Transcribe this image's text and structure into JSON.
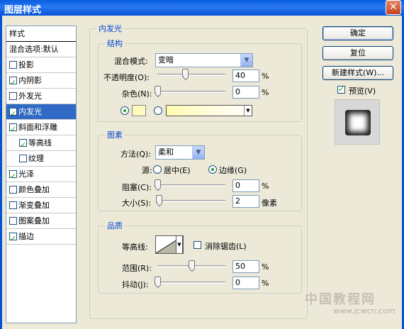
{
  "window": {
    "title": "图层样式"
  },
  "sidebar": {
    "header": "样式",
    "items": [
      {
        "label": "混合选项:默认",
        "checkbox": false,
        "checked": false,
        "selected": false
      },
      {
        "label": "投影",
        "checkbox": true,
        "checked": false,
        "selected": false
      },
      {
        "label": "内阴影",
        "checkbox": true,
        "checked": true,
        "selected": false
      },
      {
        "label": "外发光",
        "checkbox": true,
        "checked": false,
        "selected": false
      },
      {
        "label": "内发光",
        "checkbox": true,
        "checked": true,
        "selected": true
      },
      {
        "label": "斜面和浮雕",
        "checkbox": true,
        "checked": true,
        "selected": false
      },
      {
        "label": "等高线",
        "checkbox": true,
        "checked": true,
        "selected": false,
        "sub": true
      },
      {
        "label": "纹理",
        "checkbox": true,
        "checked": false,
        "selected": false,
        "sub": true
      },
      {
        "label": "光泽",
        "checkbox": true,
        "checked": true,
        "selected": false
      },
      {
        "label": "颜色叠加",
        "checkbox": true,
        "checked": false,
        "selected": false
      },
      {
        "label": "渐变叠加",
        "checkbox": true,
        "checked": false,
        "selected": false
      },
      {
        "label": "图案叠加",
        "checkbox": true,
        "checked": false,
        "selected": false
      },
      {
        "label": "描边",
        "checkbox": true,
        "checked": true,
        "selected": false
      }
    ]
  },
  "panel": {
    "title": "内发光"
  },
  "structure": {
    "legend": "结构",
    "blend_mode_label": "混合模式:",
    "blend_mode_value": "变暗",
    "opacity_label": "不透明度(O):",
    "opacity_value": "40",
    "opacity_unit": "%",
    "noise_label": "杂色(N):",
    "noise_value": "0",
    "noise_unit": "%",
    "glow_color": "#fff9c0"
  },
  "elements": {
    "legend": "图素",
    "method_label": "方法(Q):",
    "method_value": "柔和",
    "source_label": "源:",
    "source_center_label": "居中(E)",
    "source_edge_label": "边缘(G)",
    "choke_label": "阻塞(C):",
    "choke_value": "0",
    "choke_unit": "%",
    "size_label": "大小(S):",
    "size_value": "2",
    "size_unit": "像素"
  },
  "quality": {
    "legend": "品质",
    "contour_label": "等高线:",
    "antialias_label": "消除锯齿(L)",
    "range_label": "范围(R):",
    "range_value": "50",
    "range_unit": "%",
    "jitter_label": "抖动(J):",
    "jitter_value": "0",
    "jitter_unit": "%"
  },
  "buttons": {
    "ok": "确定",
    "reset": "复位",
    "new_style": "新建样式(W)...",
    "preview_label": "预览(V)"
  },
  "watermark": {
    "text": "中国教程网",
    "url": "www.jcwcn.com"
  }
}
